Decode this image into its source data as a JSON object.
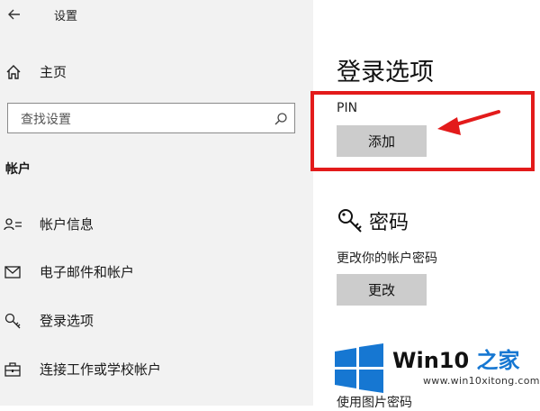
{
  "window": {
    "title": "设置",
    "back_icon": "arrow-left-icon"
  },
  "nav": {
    "home": {
      "label": "主页",
      "icon": "home-icon"
    },
    "search": {
      "placeholder": "查找设置",
      "icon": "search-icon"
    },
    "section_title": "帐户",
    "items": [
      {
        "label": "帐户信息",
        "icon": "account-info-icon"
      },
      {
        "label": "电子邮件和帐户",
        "icon": "mail-icon"
      },
      {
        "label": "登录选项",
        "icon": "key-icon"
      },
      {
        "label": "连接工作或学校帐户",
        "icon": "briefcase-icon"
      }
    ]
  },
  "main": {
    "page_title": "登录选项",
    "pin": {
      "label": "PIN",
      "button": "添加"
    },
    "password": {
      "title": "密码",
      "icon": "key-icon",
      "description": "更改你的帐户密码",
      "button": "更改"
    },
    "cut_off_text": "使用图片密码"
  },
  "annotation": {
    "highlight_color": "#e31b1b",
    "arrow_color": "#e31b1b"
  },
  "watermark": {
    "brand_prefix": "Win10",
    "brand_suffix": " 之家",
    "url": "www.win10xitong.com",
    "logo_color": "#1677d2"
  }
}
